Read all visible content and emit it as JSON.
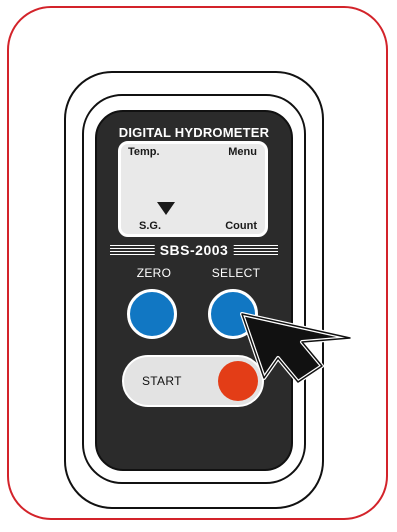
{
  "device": {
    "title": "DIGITAL HYDROMETER",
    "model": "SBS-2003",
    "display": {
      "top_left": "Temp.",
      "top_right": "Menu",
      "bottom_left": "S.G.",
      "bottom_right": "Count",
      "pointer_icon": "triangle-down-icon"
    },
    "buttons": {
      "zero_label": "ZERO",
      "select_label": "SELECT",
      "start_label": "START"
    }
  },
  "colors": {
    "frame": "#d3232a",
    "device_body": "#2b2b2b",
    "blue_button": "#1177c3",
    "start_button": "#e33d17",
    "lcd": "#e9e9e9"
  },
  "overlay": {
    "pointer": "arrow-cursor-icon",
    "target": "select_button"
  }
}
